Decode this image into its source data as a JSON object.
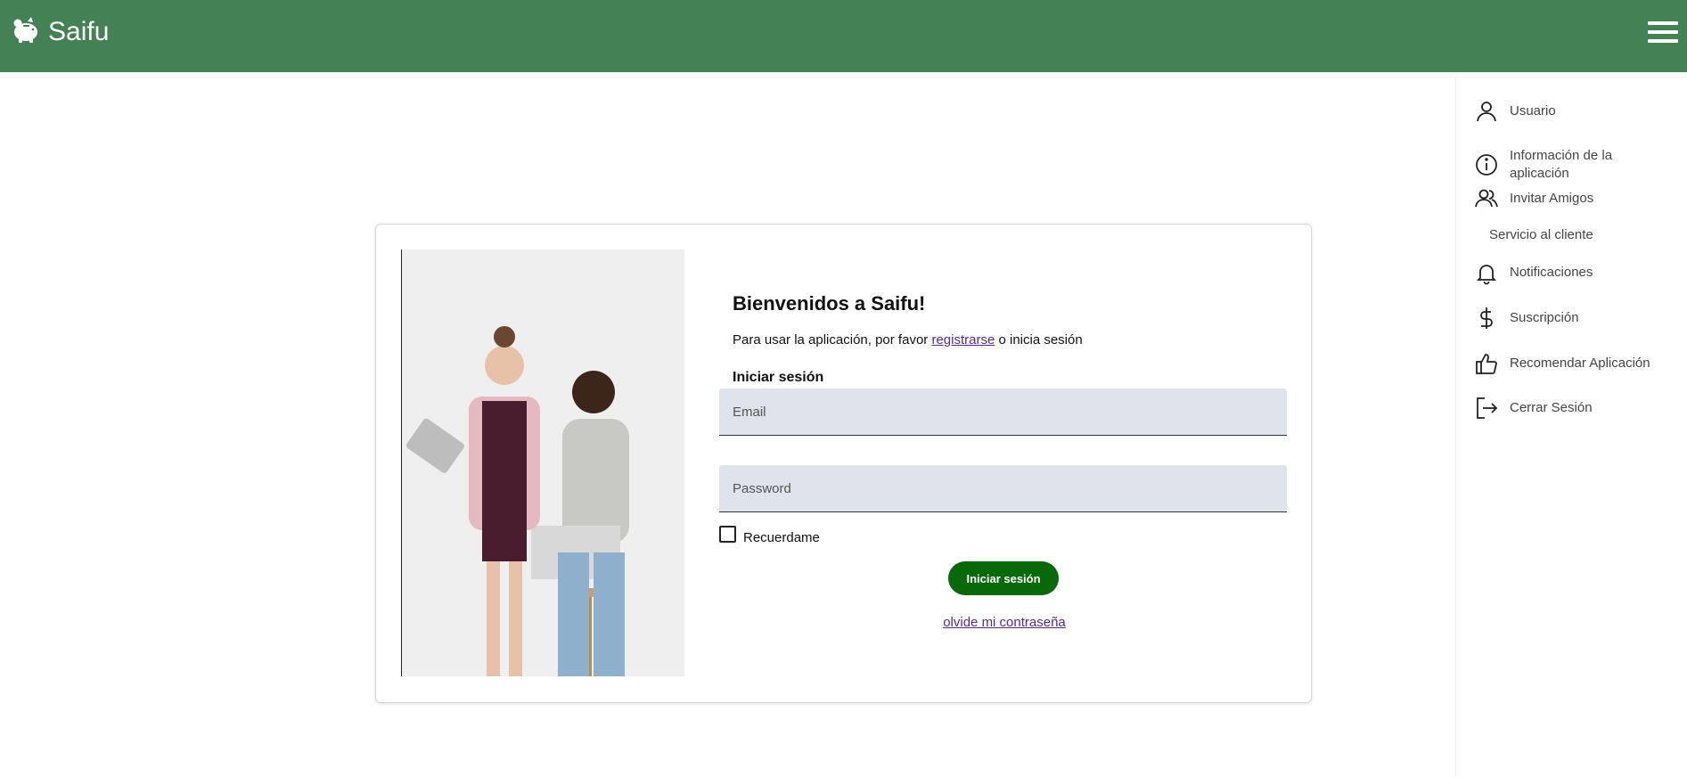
{
  "header": {
    "brand_name": "Saifu",
    "brand_icon": "piggy-bank-icon",
    "menu_icon": "hamburger-menu-icon",
    "background_color": "#448155"
  },
  "sidebar": {
    "items": [
      {
        "label": "Usuario",
        "icon": "user-icon"
      },
      {
        "label": "Información de la aplicación",
        "icon": "info-icon"
      },
      {
        "label": "Invitar Amigos",
        "icon": "people-icon"
      },
      {
        "label": "Servicio al cliente",
        "icon": ""
      },
      {
        "label": "Notificaciones",
        "icon": "bell-icon"
      },
      {
        "label": "Suscripción",
        "icon": "dollar-icon"
      },
      {
        "label": "Recomendar Aplicación",
        "icon": "thumbs-up-icon"
      },
      {
        "label": "Cerrar Sesión",
        "icon": "logout-icon"
      }
    ]
  },
  "login": {
    "welcome": "Bienvenidos a Saifu!",
    "intro_before": "Para usar la aplicación, por favor ",
    "register_link": "registrarse",
    "intro_after": " o inicia sesión",
    "section_title": "Iniciar sesión",
    "email_placeholder": "Email",
    "password_placeholder": "Password",
    "remember_label": "Recuerdame",
    "submit_label": "Iniciar sesión",
    "forgot_link": "olvide mi contraseña",
    "button_color": "#07690a"
  }
}
